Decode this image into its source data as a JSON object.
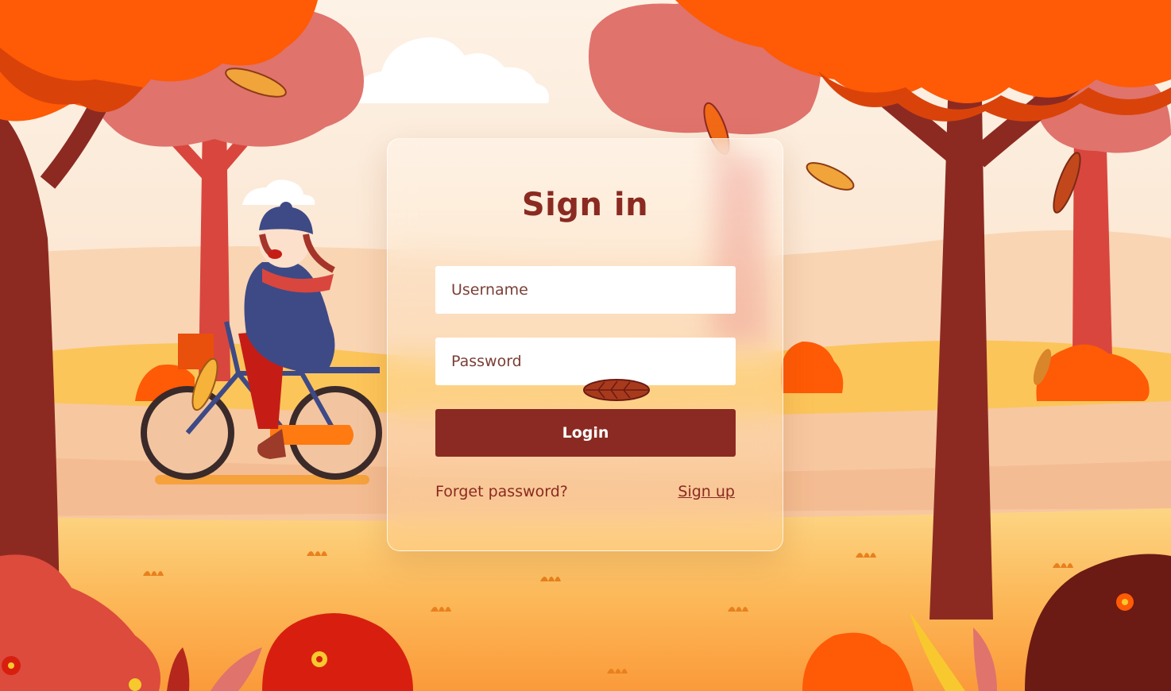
{
  "login_form": {
    "title": "Sign in",
    "username_placeholder": "Username",
    "password_placeholder": "Password",
    "login_label": "Login",
    "forget_password_label": "Forget password?",
    "signup_label": "Sign up"
  },
  "colors": {
    "accent": "#8b2a22",
    "background_sky": "#fdf0e2",
    "foliage_orange": "#ff5a05",
    "foliage_pink": "#e0706a",
    "trunk": "#8c2a22"
  },
  "illustration": {
    "scene": "autumn-forest",
    "icons": [
      "tree-icon",
      "leaf-icon",
      "cloud-icon",
      "bicycle-icon",
      "bush-icon",
      "flower-icon"
    ]
  }
}
